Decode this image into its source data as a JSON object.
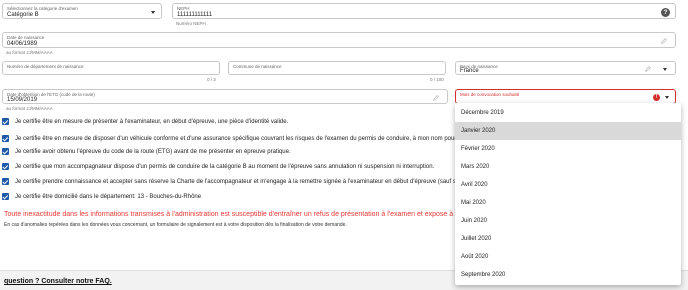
{
  "fields": {
    "exam_category": {
      "label": "Sélectionnez la catégorie d'examen",
      "value": "Catégorie B"
    },
    "neph": {
      "label": "NEPH",
      "value": "111111111111",
      "helper": "Numéro NEPH"
    },
    "birth_date": {
      "label": "Date de naissance",
      "value": "04/06/1989",
      "helper": "au format JJ/MM/AAAA"
    },
    "birth_department": {
      "label": "Numéro de département de naissance",
      "value": "",
      "counter": "0 / 3"
    },
    "birth_commune": {
      "label": "Commune de naissance",
      "value": "",
      "counter": "0 / 100"
    },
    "birth_place": {
      "label": "Pays de naissance",
      "value": "France"
    },
    "etg_date": {
      "label": "Date d'obtention de l'ETG (code de la route)",
      "value": "15/09/2019",
      "helper": "au format JJ/MM/AAAA"
    },
    "convocation_month": {
      "label": "Mois de convocation souhaité",
      "error_badge": "!"
    }
  },
  "certifications": [
    {
      "text": "Je certifie être en mesure de présenter à l'examinateur, en début d'épreuve, une pièce d'identité valide."
    },
    {
      "text": "Je certifie être en mesure de disposer d'un véhicule conforme et d'une assurance spécifique couvrant les risques de l'examen du permis de conduire, à mon nom pour la date"
    },
    {
      "text": "Je certifie avoir obtenu l'épreuve du code de la route (ETG) avant de me présenter en épreuve pratique."
    },
    {
      "text": "Je certifie que mon accompagnateur dispose d'un permis de conduire de la catégorie B au moment de l'épreuve sans annulation ni suspension ni interruption."
    },
    {
      "text": "Je certifie prendre connaissance et accepter sans réserve la Charte de l'accompagnateur et m'engage à la remettre signée à l'examinateur en début d'épreuve (sauf si l'accomp"
    },
    {
      "text": "Je certifie être domicilié dans le département: 13 - Bouches-du-Rhône"
    }
  ],
  "warning": "Toute inexactitude dans les informations transmises à l'administration est susceptible d'entraîner un refus de présentation à l'examen et expose à des sanctio",
  "note": "En cas d'anomalies repérées dans les données vous concernant, un formulaire de signalement est à votre disposition dès la finalisation de votre demande.",
  "footer": {
    "faq_link": "question ? Consulter notre FAQ."
  },
  "months_dropdown": {
    "selected_index": 1,
    "options": [
      "Décembre 2019",
      "Janvier 2020",
      "Février 2020",
      "Mars 2020",
      "Avril 2020",
      "Mai 2020",
      "Juin 2020",
      "Juillet 2020",
      "Août 2020",
      "Septembre 2020"
    ]
  },
  "colors": {
    "accent": "#1e5aa8",
    "error": "#d32f2f",
    "warning_text": "#e53935"
  },
  "icons": {
    "dropdown": "caret-down-icon",
    "edit": "pencil-icon",
    "help": "help-icon",
    "error": "error-icon"
  }
}
